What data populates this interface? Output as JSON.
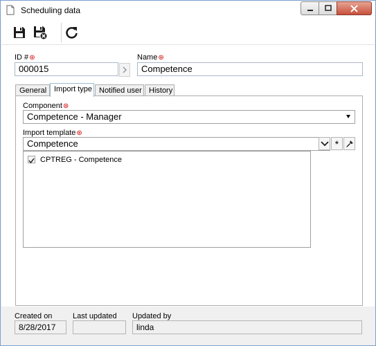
{
  "window": {
    "title": "Scheduling data",
    "buttons": [
      "minimize",
      "maximize",
      "close"
    ]
  },
  "toolbar": {
    "items": [
      {
        "name": "save",
        "icon": "floppy-disk-icon"
      },
      {
        "name": "save-and-close",
        "icon": "floppy-disk-close-icon"
      },
      {
        "name": "refresh",
        "icon": "refresh-icon"
      }
    ]
  },
  "form": {
    "id_label": "ID #",
    "id_value": "000015",
    "name_label": "Name",
    "name_value": "Competence"
  },
  "tabs": [
    {
      "label": "General",
      "active": false
    },
    {
      "label": "Import type",
      "active": true
    },
    {
      "label": "Notified user",
      "active": false
    },
    {
      "label": "History",
      "active": false
    }
  ],
  "import_type": {
    "component_label": "Component",
    "component_value": "Competence - Manager",
    "template_label": "Import template",
    "template_value": "Competence",
    "list_items": [
      {
        "checked": true,
        "label": "CPTREG - Competence"
      }
    ]
  },
  "footer": {
    "created_label": "Created on",
    "created_value": "8/28/2017",
    "updated_label": "Last updated",
    "updated_value": "",
    "updated_by_label": "Updated by",
    "updated_by_value": "linda"
  },
  "colors": {
    "required_marker": "#d00000",
    "active_tab_border": "#9cbad0",
    "close_button": "#c7503c"
  }
}
